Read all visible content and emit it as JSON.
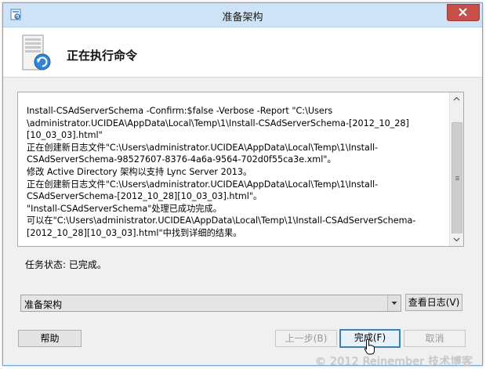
{
  "window": {
    "title": "准备架构"
  },
  "header": {
    "heading": "正在执行命令"
  },
  "log": {
    "text": "Install-CSAdServerSchema -Confirm:$false -Verbose -Report \"C:\\Users\n\\administrator.UCIDEA\\AppData\\Local\\Temp\\1\\Install-CSAdServerSchema-[2012_10_28]\n[10_03_03].html\"\n正在创建新日志文件\"C:\\Users\\administrator.UCIDEA\\AppData\\Local\\Temp\\1\\Install-\nCSAdServerSchema-98527607-8376-4a6a-9564-702d0f55ca3e.xml\"。\n修改 Active Directory 架构以支持 Lync Server 2013。\n正在创建新日志文件\"C:\\Users\\administrator.UCIDEA\\AppData\\Local\\Temp\\1\\Install-\nCSAdServerSchema-[2012_10_28][10_03_03].html\"。\n\"Install-CSAdServerSchema\"处理已成功完成。\n可以在\"C:\\Users\\administrator.UCIDEA\\AppData\\Local\\Temp\\1\\Install-CSAdServerSchema-\n[2012_10_28][10_03_03].html\"中找到详细的结果。"
  },
  "status": {
    "text": "任务状态: 已完成。"
  },
  "combo": {
    "value": "准备架构"
  },
  "buttons": {
    "view_log": "查看日志(V)",
    "help": "帮助",
    "back": "上一步(B)",
    "finish": "完成(F)",
    "cancel": "取消"
  },
  "watermark": "© 2012 Reinember 技术博客",
  "colors": {
    "titlebar": "#cfe3f6",
    "close": "#c74f4a",
    "default_button_border": "#3c7fb1"
  },
  "icons": [
    "window-app-icon",
    "close-icon",
    "server-refresh-icon",
    "scroll-up-icon",
    "scroll-down-icon",
    "dropdown-arrow-icon",
    "mouse-cursor-icon"
  ]
}
